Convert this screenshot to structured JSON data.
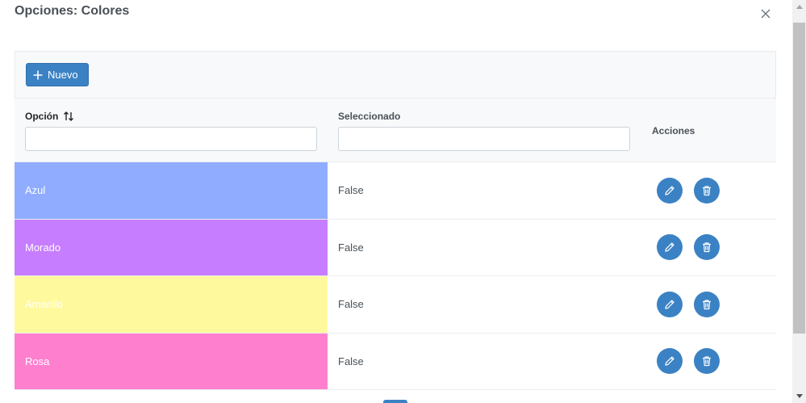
{
  "dialog": {
    "title": "Opciones: Colores"
  },
  "toolbar": {
    "new_label": "Nuevo"
  },
  "table": {
    "columns": {
      "opcion": "Opción",
      "seleccionado": "Seleccionado",
      "acciones": "Acciones"
    },
    "filters": {
      "opcion_value": "",
      "seleccionado_value": ""
    },
    "rows": [
      {
        "option": "Azul",
        "color": "#8facff",
        "selected": "False"
      },
      {
        "option": "Morado",
        "color": "#c77dff",
        "selected": "False"
      },
      {
        "option": "Amarillo",
        "color": "#fff99e",
        "selected": "False"
      },
      {
        "option": "Rosa",
        "color": "#ff7fcf",
        "selected": "False"
      }
    ]
  },
  "colors": {
    "primary": "#3b82c4"
  },
  "icons": {
    "close": "close-icon",
    "add": "plus-icon",
    "sort": "sort-icon",
    "edit": "pencil-icon",
    "delete": "trash-icon"
  }
}
